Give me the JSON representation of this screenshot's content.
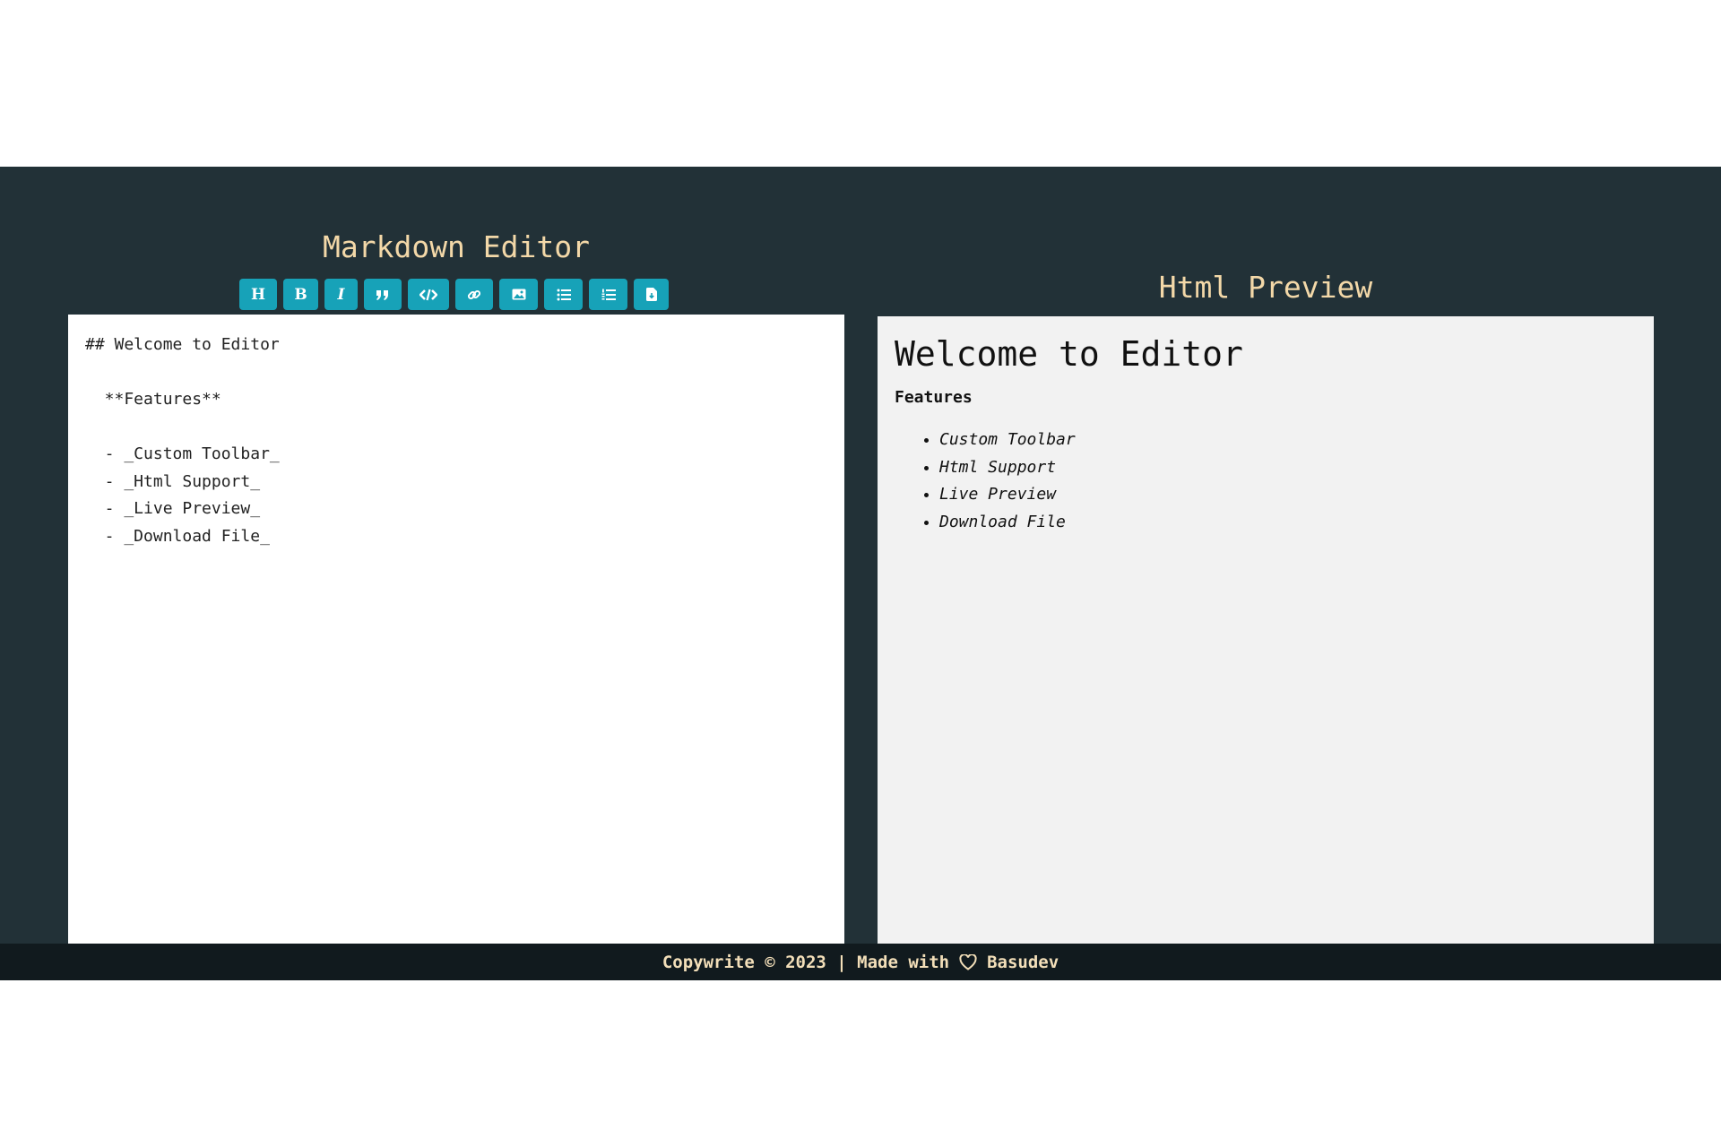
{
  "editor": {
    "title": "Markdown Editor",
    "toolbar": [
      {
        "name": "heading-button",
        "icon": "heading-icon",
        "glyph": "H"
      },
      {
        "name": "bold-button",
        "icon": "bold-icon",
        "glyph": "B"
      },
      {
        "name": "italic-button",
        "icon": "italic-icon",
        "glyph": "I"
      },
      {
        "name": "quote-button",
        "icon": "quote-icon",
        "glyph": ""
      },
      {
        "name": "code-button",
        "icon": "code-icon",
        "glyph": ""
      },
      {
        "name": "link-button",
        "icon": "link-icon",
        "glyph": ""
      },
      {
        "name": "image-button",
        "icon": "image-icon",
        "glyph": ""
      },
      {
        "name": "unordered-list-button",
        "icon": "list-ul-icon",
        "glyph": ""
      },
      {
        "name": "ordered-list-button",
        "icon": "list-ol-icon",
        "glyph": ""
      },
      {
        "name": "download-button",
        "icon": "file-download-icon",
        "glyph": ""
      }
    ],
    "lines": [
      "## Welcome to Editor",
      "",
      "  **Features**",
      "",
      "  - _Custom Toolbar_",
      "  - _Html Support_",
      "  - _Live Preview_",
      "  - _Download File_"
    ]
  },
  "preview": {
    "title": "Html Preview",
    "heading": "Welcome to Editor",
    "strong": "Features",
    "items": [
      "Custom Toolbar",
      "Html Support",
      "Live Preview",
      "Download File"
    ]
  },
  "footer": {
    "left": "Copywrite © 2023 | Made with",
    "right": "Basudev"
  },
  "colors": {
    "background": "#223137",
    "footer": "#111a1e",
    "accent": "#17a2b8",
    "title": "#f3d8a8"
  }
}
